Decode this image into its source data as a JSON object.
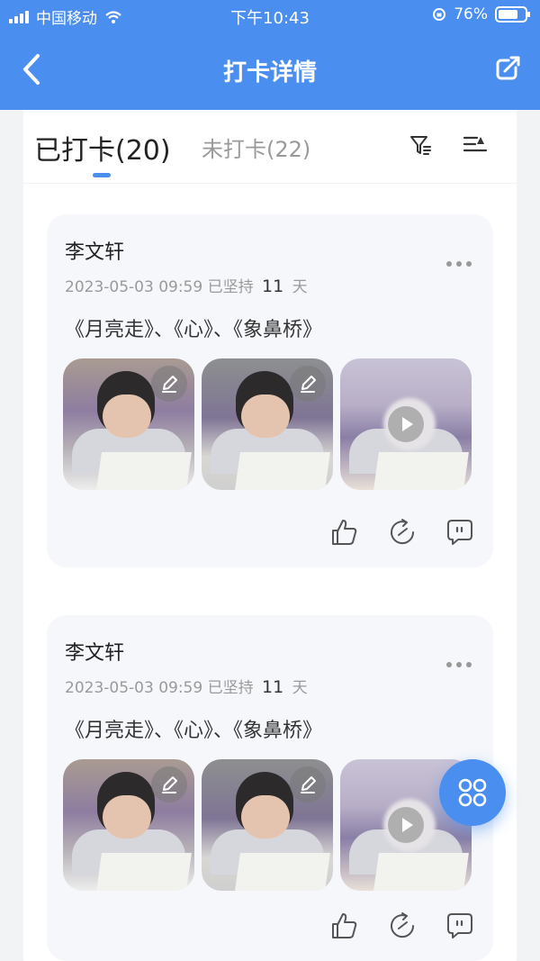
{
  "status_bar": {
    "carrier": "中国移动",
    "time": "下午10:43",
    "battery_percent": "76%",
    "battery_level": 0.76
  },
  "nav": {
    "title": "打卡详情"
  },
  "tabs": {
    "active_label": "已打卡(20)",
    "inactive_label": "未打卡(22)"
  },
  "cards": [
    {
      "name": "李文轩",
      "date": "2023-05-03 09:59",
      "persist_prefix": "已坚持",
      "days": "11",
      "days_suffix": "天",
      "content": "《月亮走》、《心》、《象鼻桥》"
    },
    {
      "name": "李文轩",
      "date": "2023-05-03 09:59",
      "persist_prefix": "已坚持",
      "days": "11",
      "days_suffix": "天",
      "content": "《月亮走》、《心》、《象鼻桥》"
    }
  ],
  "colors": {
    "primary": "#4a8ff0",
    "card_bg": "#f5f7fb"
  }
}
